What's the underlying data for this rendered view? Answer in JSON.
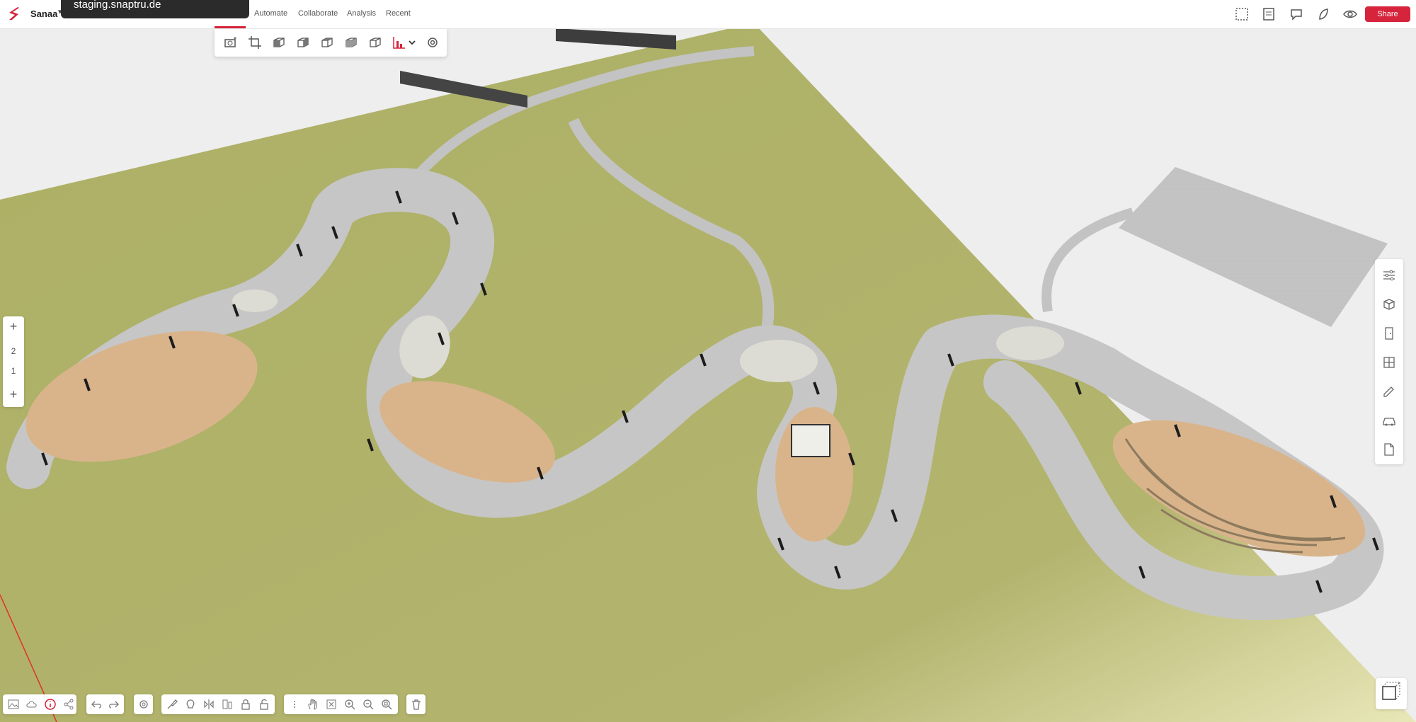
{
  "project": {
    "name": "Sanaa"
  },
  "tooltip": {
    "text": "staging.snaptru.de"
  },
  "menu": {
    "items": [
      "Automate",
      "Collaborate",
      "Analysis",
      "Recent"
    ]
  },
  "header": {
    "share_label": "Share"
  },
  "zoom_panel": {
    "levels": [
      "2",
      "1"
    ]
  },
  "colors": {
    "accent": "#d5243c",
    "ground": "#b1b36c",
    "path": "#c6c6c6",
    "deck": "#d9b48b"
  },
  "icons": {
    "topbar": [
      "plan-view-icon",
      "sheets-icon",
      "comments-icon",
      "sustainability-leaf-icon",
      "view-eye-icon"
    ],
    "toolbar": [
      "camera-add-icon",
      "crop-icon",
      "cube-front-icon",
      "cube-side-icon",
      "cube-top-icon",
      "cube-iso-icon",
      "cube-wire-icon",
      "elevation-chart-icon",
      "settings-icon"
    ],
    "right_panel": [
      "properties-sliders-icon",
      "materials-box-icon",
      "door-icon",
      "window-grid-icon",
      "measure-pencil-icon",
      "furniture-car-icon",
      "document-icon"
    ]
  }
}
